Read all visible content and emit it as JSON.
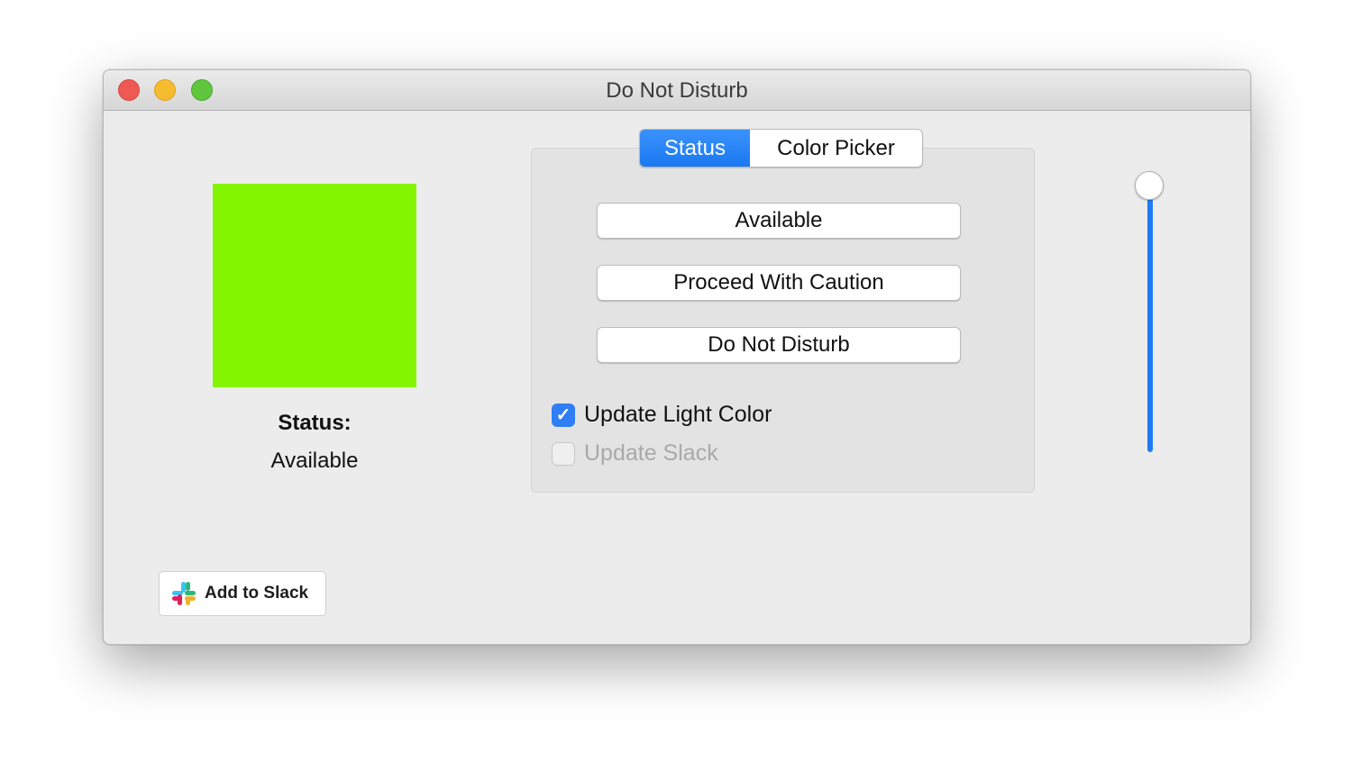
{
  "window": {
    "title": "Do Not Disturb",
    "controls": [
      "close",
      "minimize",
      "zoom"
    ]
  },
  "status_display": {
    "swatch_color": "#84f500",
    "label": "Status:",
    "value": "Available"
  },
  "tabs": [
    {
      "label": "Status",
      "selected": true
    },
    {
      "label": "Color Picker",
      "selected": false
    }
  ],
  "status_buttons": [
    {
      "label": "Available"
    },
    {
      "label": "Proceed With Caution"
    },
    {
      "label": "Do Not Disturb"
    }
  ],
  "options": [
    {
      "label": "Update Light Color",
      "checked": true,
      "enabled": true
    },
    {
      "label": "Update Slack",
      "checked": false,
      "enabled": false
    }
  ],
  "brightness_slider": {
    "value_percent": 100,
    "accent_color": "#1f7cf5"
  },
  "slack_button": {
    "label": "Add to Slack",
    "icon": "slack-logo-icon"
  }
}
